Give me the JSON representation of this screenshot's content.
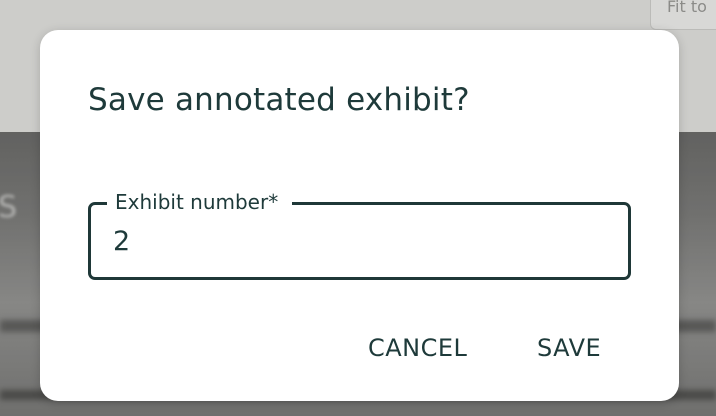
{
  "background": {
    "zoom_text": "Fit to",
    "blurred_text": "S"
  },
  "dialog": {
    "title": "Save annotated exhibit?",
    "field": {
      "label": "Exhibit number*",
      "value": "2"
    },
    "actions": {
      "cancel_label": "CANCEL",
      "save_label": "SAVE"
    }
  },
  "colors": {
    "text_primary": "#1e3a3a",
    "field_border": "#1f3838",
    "dialog_background": "#ffffff"
  }
}
